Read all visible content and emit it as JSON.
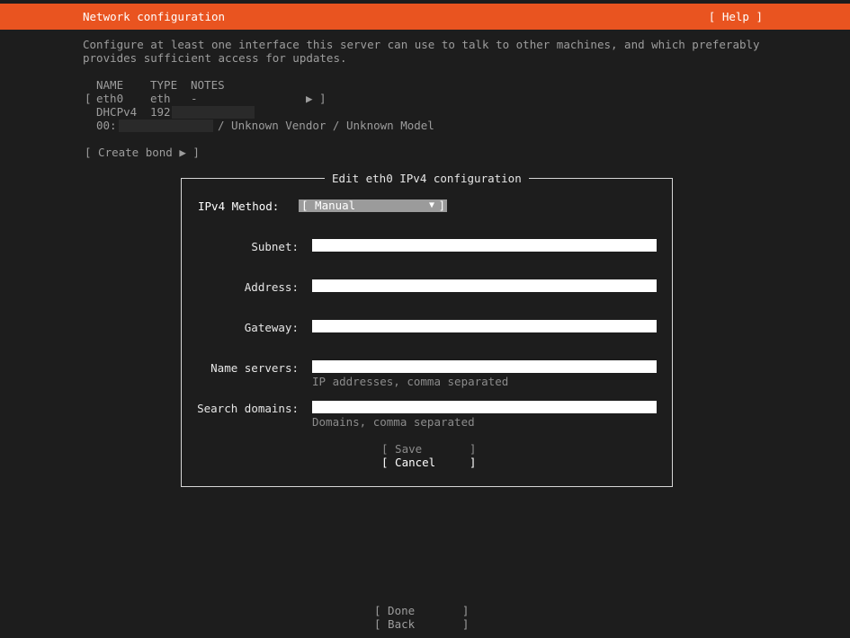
{
  "header": {
    "title": "Network configuration",
    "help": "[ Help ]"
  },
  "intro": {
    "line1": "Configure at least one interface this server can use to talk to other machines, and which preferably",
    "line2": "provides sufficient access for updates."
  },
  "interfaces": {
    "headers": {
      "name": "NAME",
      "type": "TYPE",
      "notes": "NOTES"
    },
    "row": {
      "open": "[",
      "name": "eth0",
      "type": "eth",
      "notes": "-",
      "arrow": "▶ ]"
    },
    "dhcp": {
      "label": "DHCPv4",
      "value": "192"
    },
    "mac": {
      "prefix": "00:",
      "vendor": "/ Unknown Vendor / Unknown Model"
    }
  },
  "create_bond": "[ Create bond ▶ ]",
  "dialog": {
    "title": "Edit eth0 IPv4 configuration",
    "method": {
      "label": "IPv4 Method:",
      "value": "[ Manual",
      "arrow": "▼",
      "close": "]"
    },
    "fields": {
      "subnet": {
        "label": "Subnet:",
        "value": ""
      },
      "address": {
        "label": "Address:",
        "value": ""
      },
      "gateway": {
        "label": "Gateway:",
        "value": ""
      },
      "name_servers": {
        "label": "Name servers:",
        "value": "",
        "hint": "IP addresses, comma separated"
      },
      "search_domains": {
        "label": "Search domains:",
        "value": "",
        "hint": "Domains, comma separated"
      }
    },
    "save": "[ Save       ]",
    "cancel": "[ Cancel     ]"
  },
  "footer": {
    "done": "[ Done       ]",
    "back": "[ Back       ]"
  },
  "colors": {
    "accent": "#e95420",
    "background": "#1d1d1d"
  }
}
